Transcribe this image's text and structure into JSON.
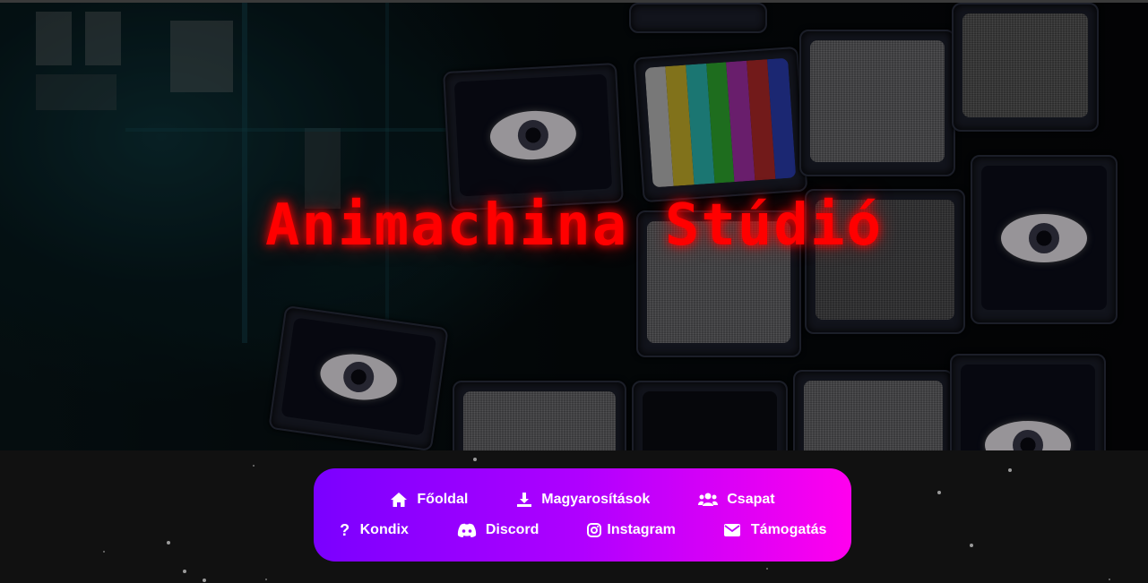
{
  "hero": {
    "title": "Animachina Stúdió"
  },
  "nav": {
    "row1": [
      {
        "label": "Főoldal",
        "icon": "home-icon"
      },
      {
        "label": "Magyarosítások",
        "icon": "download-icon"
      },
      {
        "label": "Csapat",
        "icon": "users-icon"
      }
    ],
    "row2": [
      {
        "label": "Kondix",
        "icon": "question-icon"
      },
      {
        "label": "Discord",
        "icon": "discord-icon"
      },
      {
        "label": "Instagram",
        "icon": "instagram-icon"
      },
      {
        "label": "Támogatás",
        "icon": "envelope-icon"
      }
    ]
  },
  "colors": {
    "title": "#ff0000",
    "nav_gradient_start": "#7a00ff",
    "nav_gradient_end": "#ff00ee",
    "page_background": "#111111"
  }
}
